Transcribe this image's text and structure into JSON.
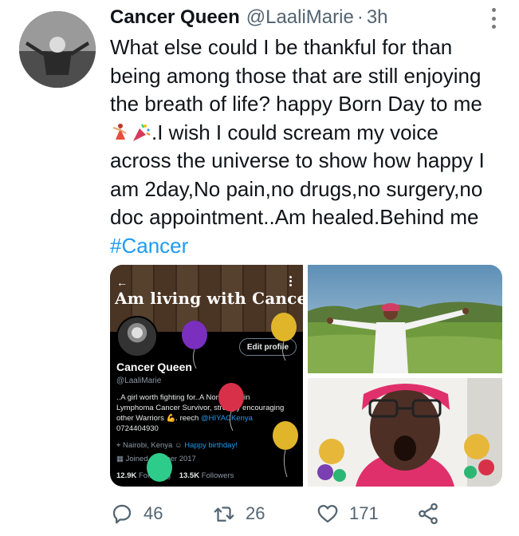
{
  "tweet": {
    "author_name": "Cancer Queen",
    "handle": "@LaaliMarie",
    "separator": "·",
    "time": "3h",
    "text_lines": [
      "What else could I be thankful for than",
      "being among those that are still enjoying",
      "the breath of life? happy Born Day to me",
      ".I wish I could scream my voice",
      "across the universe to show how happy I",
      "am 2day,No pain,no drugs,no surgery,no",
      "doc appointment..Am healed.Behind me"
    ],
    "hashtag": "#Cancer",
    "emojis": [
      "dancer-emoji",
      "party-popper-emoji"
    ]
  },
  "media": {
    "profile_card": {
      "banner_title": "Am living with Cancer",
      "back_arrow": "←",
      "edit_button": "Edit profile",
      "name": "Cancer Queen",
      "handle": "@LaaliMarie",
      "bio_line1": "..A girl worth fighting for..A Non Hodgkin",
      "bio_line2": "Lymphoma Cancer Survivor, strongly encouraging",
      "bio_line3_a": "other Warriors 💪. reech ",
      "bio_line3_link": "@HIYACKenya",
      "bio_line4": "0724404930",
      "location": "Nairobi, Kenya",
      "birthday": "Happy birthday!",
      "joined": "Joined October 2017",
      "following_count": "12.9K",
      "following_label": "Following",
      "followers_count": "13.5K",
      "followers_label": "Followers"
    },
    "photos": [
      "outdoor-field-photo",
      "selfie-photo"
    ]
  },
  "actions": {
    "replies": "46",
    "retweets": "26",
    "likes": "171"
  },
  "colors": {
    "link": "#1d9bf0",
    "secondary_text": "#536471",
    "primary_text": "#0f1419"
  }
}
